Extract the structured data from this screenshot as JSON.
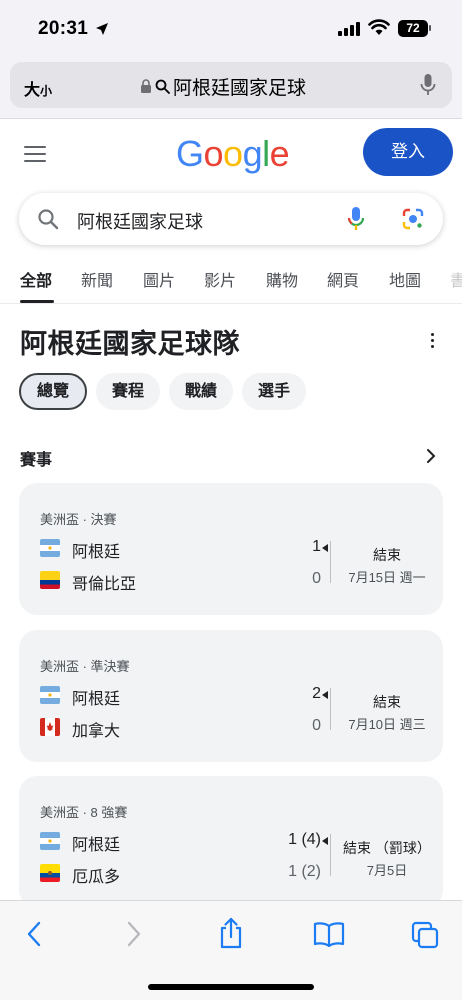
{
  "status_bar": {
    "time": "20:31",
    "battery": "72"
  },
  "browser": {
    "text_size_label": "大",
    "text_size_small": "小",
    "url": "阿根廷國家足球"
  },
  "header": {
    "logo": "Google",
    "signin_label": "登入"
  },
  "search": {
    "query": "阿根廷國家足球"
  },
  "tabs": [
    "全部",
    "新聞",
    "圖片",
    "影片",
    "購物",
    "網頁",
    "地圖",
    "書"
  ],
  "entity": {
    "title": "阿根廷國家足球隊",
    "chips": [
      "總覽",
      "賽程",
      "戰績",
      "選手"
    ]
  },
  "matches_section": {
    "title": "賽事"
  },
  "matches": [
    {
      "competition": "美洲盃 · 決賽",
      "team1": "阿根廷",
      "score1": "1",
      "flag1": "argentina",
      "team2": "哥倫比亞",
      "score2": "0",
      "flag2": "colombia",
      "status": "結束",
      "date": "7月15日 週一"
    },
    {
      "competition": "美洲盃 · 準決賽",
      "team1": "阿根廷",
      "score1": "2",
      "flag1": "argentina",
      "team2": "加拿大",
      "score2": "0",
      "flag2": "canada",
      "status": "結束",
      "date": "7月10日 週三"
    },
    {
      "competition": "美洲盃 · 8 強賽",
      "team1": "阿根廷",
      "score1": "1 (4)",
      "flag1": "argentina",
      "team2": "厄瓜多",
      "score2": "1 (2)",
      "flag2": "ecuador",
      "status": "結束 （罰球）",
      "date": "7月5日"
    }
  ],
  "colors": {
    "signin_blue": "#1a53c6",
    "card_bg": "#f1f3f4",
    "ios_blue": "#1c7cf4"
  }
}
